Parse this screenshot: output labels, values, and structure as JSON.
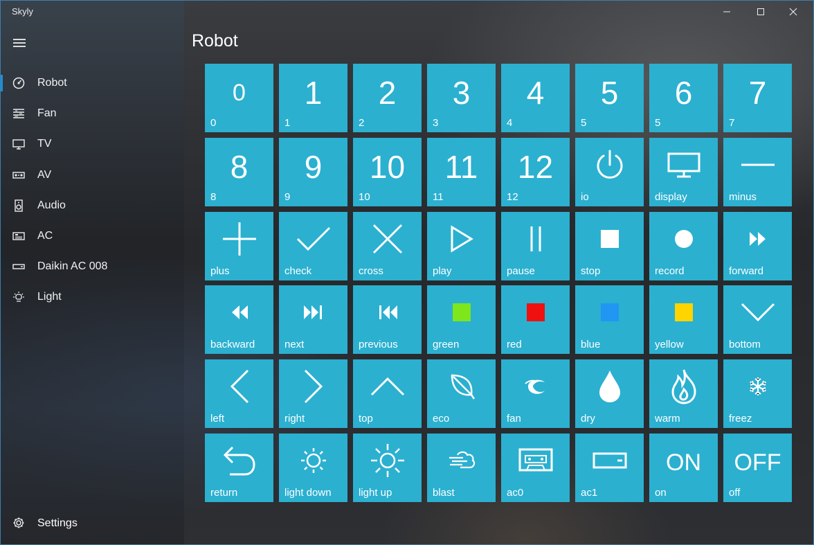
{
  "window": {
    "title": "Skyly"
  },
  "page": {
    "title": "Robot"
  },
  "sidebar": {
    "items": [
      {
        "label": "Robot",
        "icon": "gauge-icon",
        "active": true
      },
      {
        "label": "Fan",
        "icon": "fan-icon"
      },
      {
        "label": "TV",
        "icon": "tv-icon"
      },
      {
        "label": "AV",
        "icon": "av-receiver-icon"
      },
      {
        "label": "Audio",
        "icon": "speaker-icon"
      },
      {
        "label": "AC",
        "icon": "air-conditioner-icon"
      },
      {
        "label": "Daikin AC 008",
        "icon": "ac-unit-icon"
      },
      {
        "label": "Light",
        "icon": "lightbulb-icon"
      }
    ],
    "settings_label": "Settings"
  },
  "tile_color": "#2bb0d0",
  "tiles": [
    {
      "label": "0",
      "glyph": "0",
      "icon": "text-glyph"
    },
    {
      "label": "1",
      "glyph": "1",
      "icon": "text-glyph"
    },
    {
      "label": "2",
      "glyph": "2",
      "icon": "text-glyph"
    },
    {
      "label": "3",
      "glyph": "3",
      "icon": "text-glyph"
    },
    {
      "label": "4",
      "glyph": "4",
      "icon": "text-glyph"
    },
    {
      "label": "5",
      "glyph": "5",
      "icon": "text-glyph"
    },
    {
      "label": "5",
      "glyph": "6",
      "icon": "text-glyph"
    },
    {
      "label": "7",
      "glyph": "7",
      "icon": "text-glyph"
    },
    {
      "label": "8",
      "glyph": "8",
      "icon": "text-glyph"
    },
    {
      "label": "9",
      "glyph": "9",
      "icon": "text-glyph"
    },
    {
      "label": "10",
      "glyph": "10",
      "icon": "text-glyph"
    },
    {
      "label": "11",
      "glyph": "11",
      "icon": "text-glyph"
    },
    {
      "label": "12",
      "glyph": "12",
      "icon": "text-glyph"
    },
    {
      "label": "io",
      "icon": "power-icon"
    },
    {
      "label": "display",
      "icon": "monitor-icon"
    },
    {
      "label": "minus",
      "icon": "minus-icon"
    },
    {
      "label": "plus",
      "icon": "plus-icon"
    },
    {
      "label": "check",
      "icon": "check-icon"
    },
    {
      "label": "cross",
      "icon": "cross-icon"
    },
    {
      "label": "play",
      "icon": "play-icon"
    },
    {
      "label": "pause",
      "icon": "pause-icon"
    },
    {
      "label": "stop",
      "icon": "stop-icon"
    },
    {
      "label": "record",
      "icon": "record-icon"
    },
    {
      "label": "forward",
      "icon": "fast-forward-icon"
    },
    {
      "label": "backward",
      "icon": "rewind-icon"
    },
    {
      "label": "next",
      "icon": "next-track-icon"
    },
    {
      "label": "previous",
      "icon": "previous-track-icon"
    },
    {
      "label": "green",
      "icon": "color-square-icon",
      "color": "#7ee61c"
    },
    {
      "label": "red",
      "icon": "color-square-icon",
      "color": "#f01010"
    },
    {
      "label": "blue",
      "icon": "color-square-icon",
      "color": "#2196f3"
    },
    {
      "label": "yellow",
      "icon": "color-square-icon",
      "color": "#ffd400"
    },
    {
      "label": "bottom",
      "icon": "chevron-down-icon"
    },
    {
      "label": "left",
      "icon": "chevron-left-icon"
    },
    {
      "label": "right",
      "icon": "chevron-right-icon"
    },
    {
      "label": "top",
      "icon": "chevron-up-icon"
    },
    {
      "label": "eco",
      "icon": "leaf-icon"
    },
    {
      "label": "fan",
      "icon": "fan-swirl-icon"
    },
    {
      "label": "dry",
      "icon": "water-drop-icon"
    },
    {
      "label": "warm",
      "icon": "flame-icon"
    },
    {
      "label": "freez",
      "icon": "snowflake-icon"
    },
    {
      "label": "return",
      "icon": "return-arrow-icon"
    },
    {
      "label": "light down",
      "icon": "brightness-low-icon"
    },
    {
      "label": "light up",
      "icon": "brightness-high-icon"
    },
    {
      "label": "blast",
      "icon": "wind-cloud-icon"
    },
    {
      "label": "ac0",
      "icon": "cassette-icon"
    },
    {
      "label": "ac1",
      "icon": "ac-box-icon"
    },
    {
      "label": "on",
      "glyph": "ON",
      "icon": "text-glyph"
    },
    {
      "label": "off",
      "glyph": "OFF",
      "icon": "text-glyph"
    }
  ]
}
